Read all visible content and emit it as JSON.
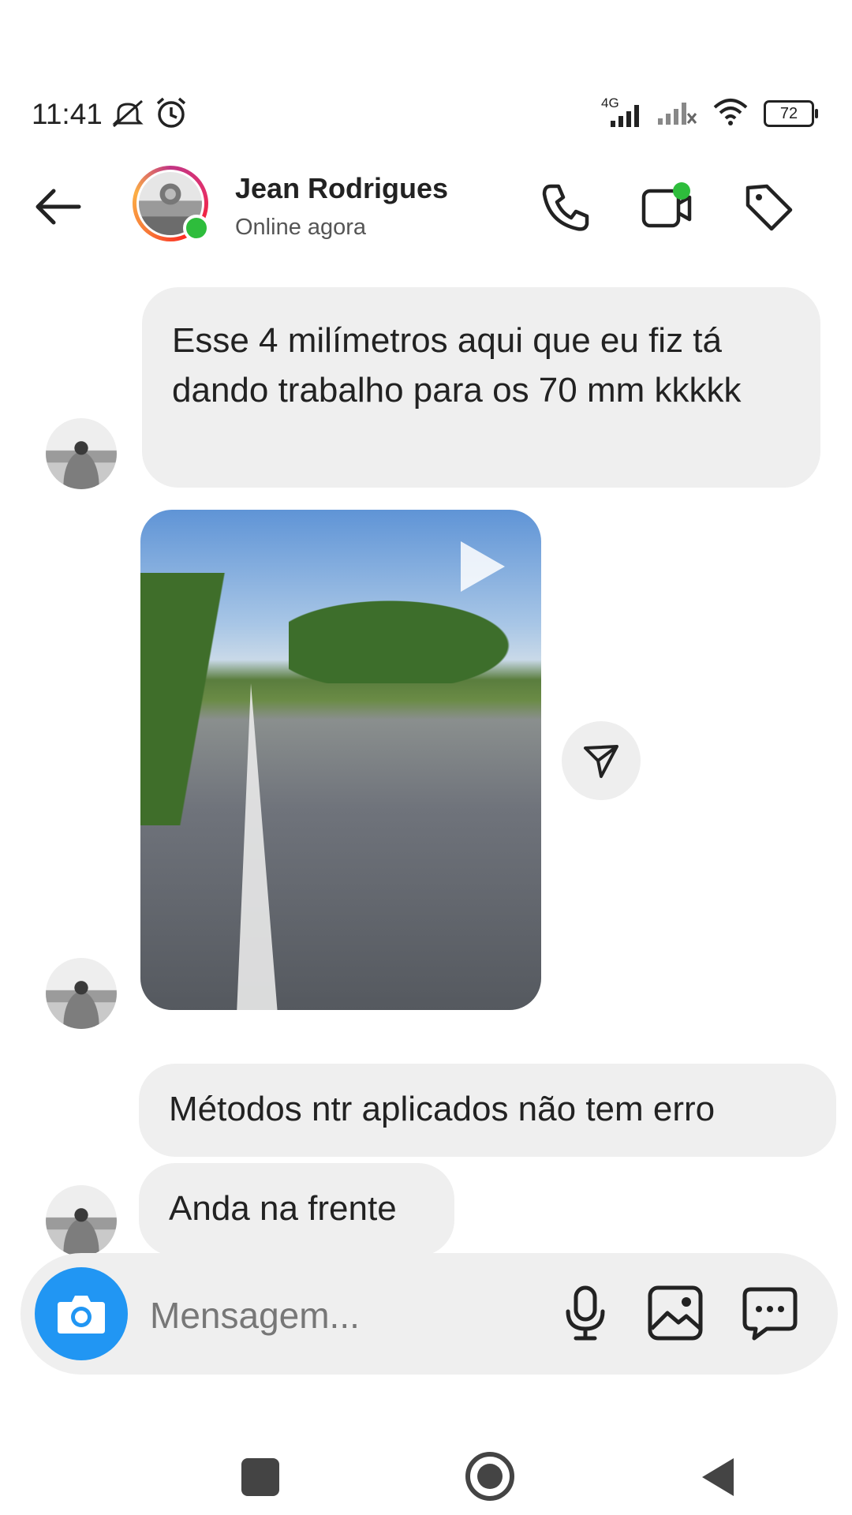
{
  "status_bar": {
    "time": "11:41",
    "network": "4G",
    "battery": "72"
  },
  "header": {
    "contact_name": "Jean Rodrigues",
    "contact_status": "Online agora",
    "icons": [
      "back-arrow-icon",
      "phone-icon",
      "video-call-icon",
      "tag-icon"
    ]
  },
  "messages": [
    {
      "type": "text",
      "text": "Esse 4 milímetros aqui que eu fiz tá dando trabalho para os 70 mm kkkkk"
    },
    {
      "type": "video"
    },
    {
      "type": "text",
      "text": "Métodos ntr aplicados não tem erro"
    },
    {
      "type": "text",
      "text": "Anda na frente"
    }
  ],
  "composer": {
    "placeholder": "Mensagem..."
  },
  "colors": {
    "camera_button": "#2196f3",
    "bubble": "#efefef",
    "online": "#2ebd3c"
  }
}
